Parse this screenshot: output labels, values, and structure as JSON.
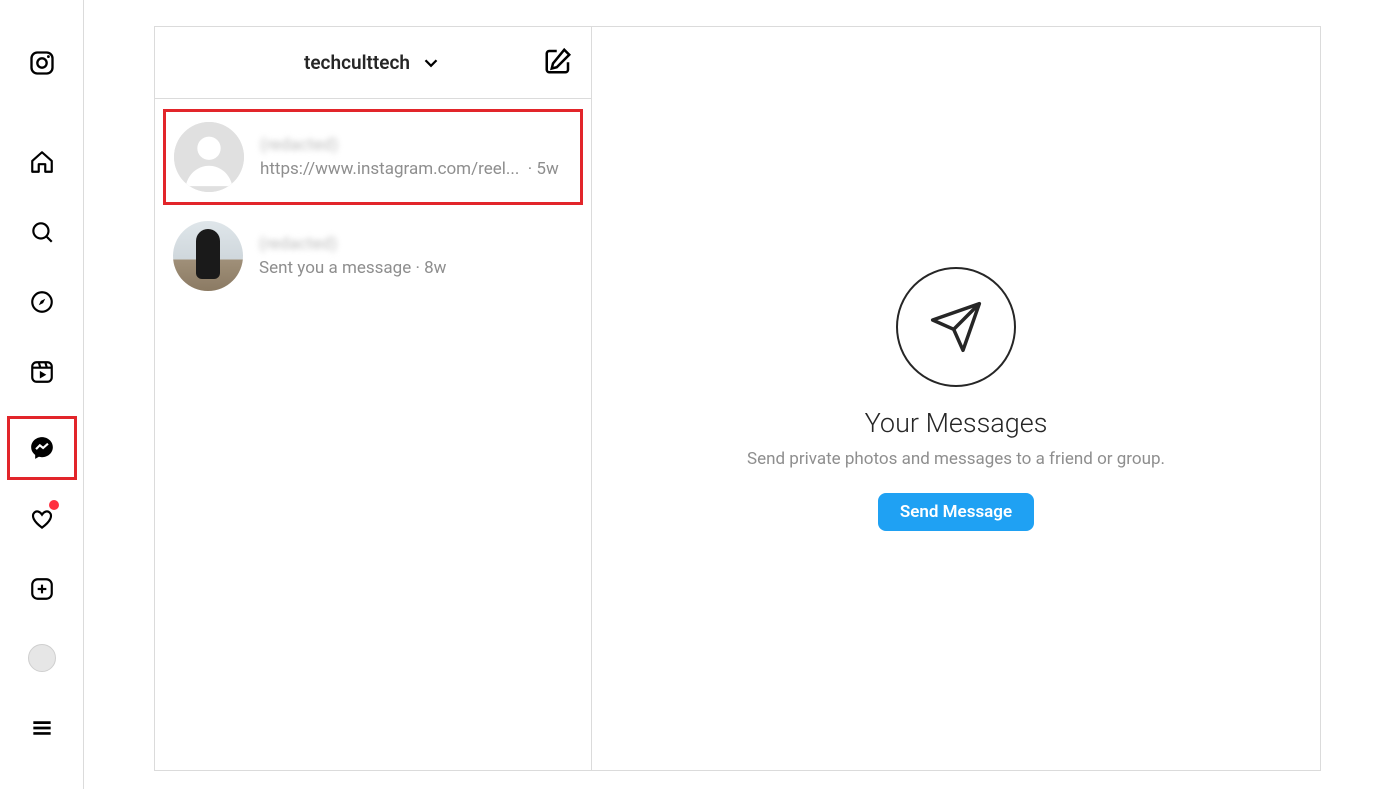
{
  "nav": {
    "items": [
      {
        "name": "logo",
        "icon": "instagram"
      },
      {
        "name": "home",
        "icon": "home"
      },
      {
        "name": "search",
        "icon": "search"
      },
      {
        "name": "explore",
        "icon": "compass"
      },
      {
        "name": "reels",
        "icon": "reels"
      },
      {
        "name": "messages",
        "icon": "messenger",
        "active": true
      },
      {
        "name": "notifications",
        "icon": "heart",
        "badge": true
      },
      {
        "name": "create",
        "icon": "plus-square"
      },
      {
        "name": "profile",
        "icon": "avatar"
      }
    ],
    "menu_name": "menu"
  },
  "inbox": {
    "account_label": "techculttech",
    "threads": [
      {
        "name": "(redacted)",
        "snippet": "https://www.instagram.com/reel...",
        "time": "5w",
        "avatar": "default",
        "highlighted": true
      },
      {
        "name": "(redacted)",
        "snippet": "Sent you a message",
        "time": "8w",
        "avatar": "photo",
        "highlighted": false
      }
    ]
  },
  "detail": {
    "title": "Your Messages",
    "subtitle": "Send private photos and messages to a friend or group.",
    "button": "Send Message"
  }
}
